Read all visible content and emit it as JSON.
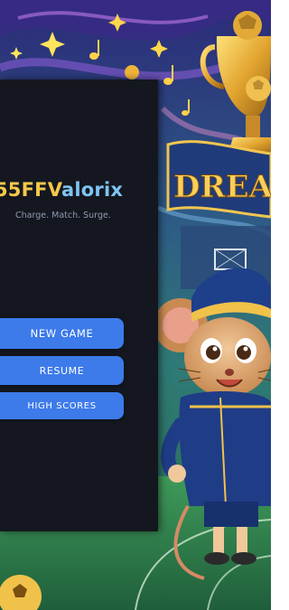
{
  "game": {
    "title_main": "55FFV",
    "title_tail": "alorix",
    "tagline": "Charge. Match. Surge."
  },
  "menu": {
    "new_game": "NEW GAME",
    "resume": "RESUME",
    "high_scores": "HIGH SCORES"
  },
  "artwork": {
    "banner_text": "DREAM",
    "subject": "cartoon mouse in football kit with golden trophy"
  },
  "colors": {
    "panel": "#14171f",
    "button": "#3d7bea",
    "title_gold": "#f5c84a",
    "title_blue": "#7ec4f2"
  }
}
